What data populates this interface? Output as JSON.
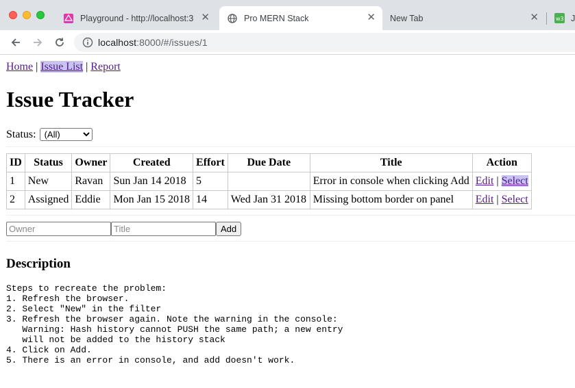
{
  "browser": {
    "tabs": [
      {
        "title": "Playground - http://localhost:3",
        "active": false
      },
      {
        "title": "Pro MERN Stack",
        "active": true
      },
      {
        "title": "New Tab",
        "active": false
      },
      {
        "title": "J",
        "active": false
      }
    ],
    "url_host": "localhost",
    "url_path": ":8000/#/issues/1",
    "colors": {
      "tabbar": "#dee1e6",
      "omnibox": "#f1f3f4"
    }
  },
  "nav": {
    "home": "Home",
    "sep1": "|",
    "issue_list": "Issue List",
    "sep2": "|",
    "report": "Report"
  },
  "page_title": "Issue Tracker",
  "filter": {
    "label": "Status:",
    "selected": "(All)"
  },
  "table": {
    "headers": [
      "ID",
      "Status",
      "Owner",
      "Created",
      "Effort",
      "Due Date",
      "Title",
      "Action"
    ],
    "rows": [
      {
        "id": "1",
        "status": "New",
        "owner": "Ravan",
        "created": "Sun Jan 14 2018",
        "effort": "5",
        "due": "",
        "title": "Error in console when clicking Add",
        "edit": "Edit",
        "sep": "|",
        "select": "Select"
      },
      {
        "id": "2",
        "status": "Assigned",
        "owner": "Eddie",
        "created": "Mon Jan 15 2018",
        "effort": "14",
        "due": "Wed Jan 31 2018",
        "title": "Missing bottom border on panel",
        "edit": "Edit",
        "sep": "|",
        "select": "Select"
      }
    ]
  },
  "add_form": {
    "owner_placeholder": "Owner",
    "title_placeholder": "Title",
    "button": "Add"
  },
  "description": {
    "heading": "Description",
    "text": "Steps to recreate the problem:\n1. Refresh the browser.\n2. Select \"New\" in the filter\n3. Refresh the browser again. Note the warning in the console:\n   Warning: Hash history cannot PUSH the same path; a new entry\n   will not be added to the history stack\n4. Click on Add.\n5. There is an error in console, and add doesn't work."
  }
}
